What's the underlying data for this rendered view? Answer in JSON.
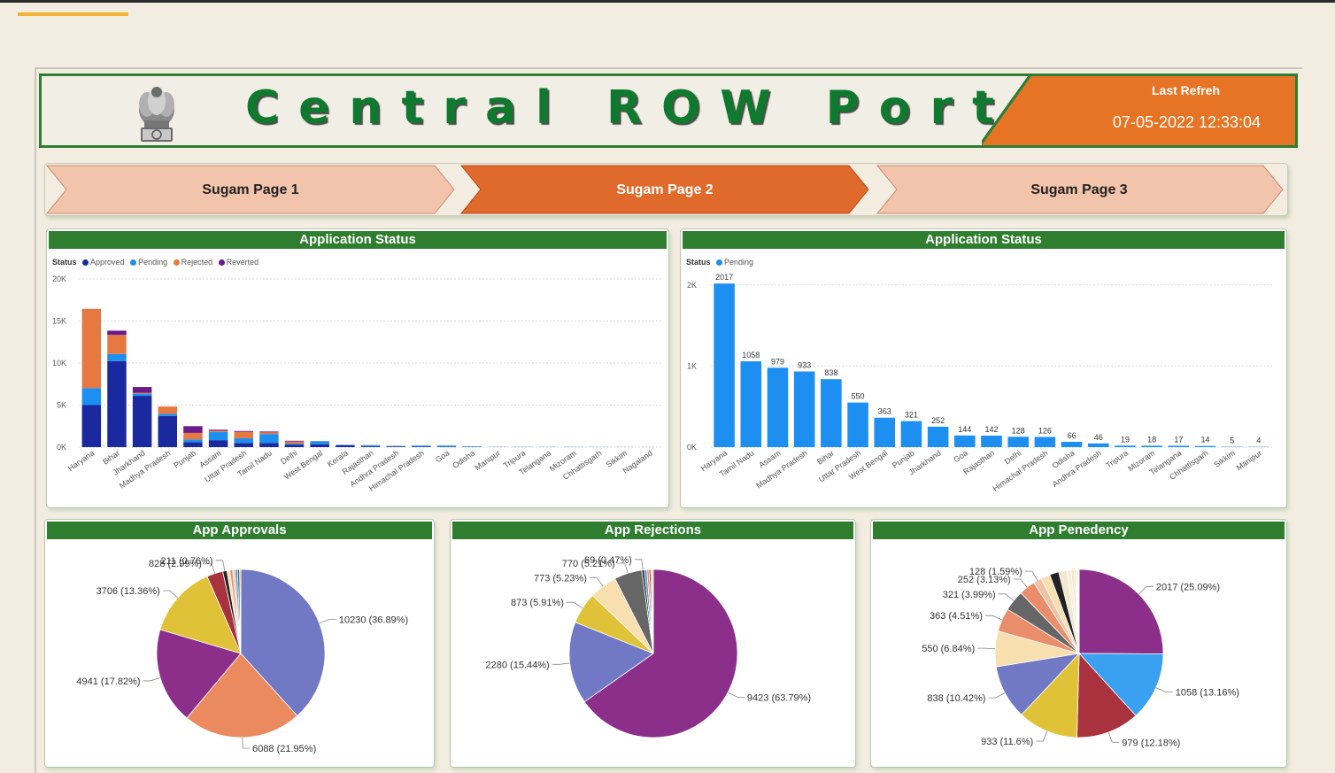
{
  "header": {
    "title": "Central ROW Portal",
    "refresh_label": "Last Refreh",
    "refresh_time": "07-05-2022 12:33:04"
  },
  "colors": {
    "green": "#2f7d2f",
    "orange": "#e06a2c",
    "pale": "#f3c4ac"
  },
  "nav": {
    "items": [
      {
        "label": "Sugam Page 1",
        "active": false
      },
      {
        "label": "Sugam Page 2",
        "active": true
      },
      {
        "label": "Sugam Page 3",
        "active": false
      }
    ]
  },
  "panels": {
    "status_title": "Application Status",
    "pending_title": "Application Status",
    "approvals_title": "App Approvals",
    "rejections_title": "App Rejections",
    "pendency_title": "App Penedency"
  },
  "legend": {
    "status_label": "Status",
    "approved": "Approved",
    "pending": "Pending",
    "rejected": "Rejected",
    "reverted": "Reverted"
  },
  "chart_data": [
    {
      "type": "bar",
      "stacked": true,
      "title": "Application Status",
      "legend_title": "Status",
      "ylim": [
        0,
        20000
      ],
      "yticks": [
        "0K",
        "5K",
        "10K",
        "15K",
        "20K"
      ],
      "categories": [
        "Haryana",
        "Bihar",
        "Jharkhand",
        "Madhya Pradesh",
        "Punjab",
        "Assam",
        "Uttar Pradesh",
        "Tamil Nadu",
        "Delhi",
        "West Bengal",
        "Kerala",
        "Rajasthan",
        "Andhra Pradesh",
        "Himachal Pradesh",
        "Goa",
        "Odisha",
        "Manipur",
        "Tripura",
        "Telangana",
        "Mizoram",
        "Chhattisgarh",
        "Sikkim",
        "Nagaland"
      ],
      "series": [
        {
          "name": "Approved",
          "color": "#1a2a9e",
          "values": [
            5000,
            10230,
            6100,
            3706,
            600,
            828,
            500,
            500,
            300,
            350,
            211,
            90,
            80,
            60,
            40,
            30,
            20,
            15,
            10,
            10,
            8,
            5,
            3
          ]
        },
        {
          "name": "Pending",
          "color": "#1c8ff0",
          "values": [
            2017,
            838,
            250,
            250,
            321,
            979,
            550,
            1058,
            128,
            363,
            60,
            142,
            66,
            126,
            144,
            66,
            4,
            19,
            17,
            18,
            14,
            5,
            2
          ]
        },
        {
          "name": "Rejected",
          "color": "#e67842",
          "values": [
            9423,
            2280,
            100,
            873,
            773,
            150,
            770,
            200,
            250,
            20,
            10,
            20,
            20,
            10,
            10,
            5,
            3,
            3,
            2,
            2,
            2,
            1,
            1
          ]
        },
        {
          "name": "Reverted",
          "color": "#6b1a8a",
          "values": [
            0,
            500,
            700,
            0,
            800,
            120,
            100,
            100,
            80,
            0,
            0,
            0,
            0,
            0,
            0,
            0,
            0,
            0,
            0,
            0,
            0,
            0,
            0
          ]
        }
      ]
    },
    {
      "type": "bar",
      "title": "Application Status",
      "legend_title": "Status",
      "ylim": [
        0,
        2500
      ],
      "yticks": [
        "0K",
        "1K",
        "2K"
      ],
      "categories": [
        "Haryana",
        "Tamil Nadu",
        "Assam",
        "Madhya Pradesh",
        "Bihar",
        "Uttar Pradesh",
        "West Bengal",
        "Punjab",
        "Jharkhand",
        "Goa",
        "Rajasthan",
        "Delhi",
        "Himachal Pradesh",
        "Odisha",
        "Andhra Pradesh",
        "Tripura",
        "Mizoram",
        "Telangana",
        "Chhattisgarh",
        "Sikkim",
        "Manipur"
      ],
      "series": [
        {
          "name": "Pending",
          "color": "#1c8ff0",
          "values": [
            2017,
            1058,
            979,
            933,
            838,
            550,
            363,
            321,
            252,
            144,
            142,
            128,
            126,
            66,
            46,
            19,
            18,
            17,
            14,
            5,
            4
          ]
        }
      ]
    },
    {
      "type": "pie",
      "title": "App Approvals",
      "values": [
        10230,
        6088,
        4941,
        3706,
        828,
        211,
        150,
        140,
        130,
        120,
        110,
        60
      ],
      "labels": [
        "10230 (36.89%)",
        "6088 (21.95%)",
        "4941 (17.82%)",
        "3706 (13.36%)",
        "828 (2.99%)",
        "211 (0.76%)",
        "",
        "",
        "",
        "",
        "",
        ""
      ],
      "colors": [
        "#7179c4",
        "#eb8a5e",
        "#8b2f8b",
        "#dfc237",
        "#a8323e",
        "#222222",
        "#f7dfb0",
        "#e98d6a",
        "#f0c2a8",
        "#3a9ad8",
        "#5a5a5a",
        "#c9a84e"
      ]
    },
    {
      "type": "pie",
      "title": "App Rejections",
      "values": [
        9423,
        2280,
        873,
        773,
        770,
        69,
        70,
        60,
        50,
        40,
        30
      ],
      "labels": [
        "9423 (63.79%)",
        "2280 (15.44%)",
        "873 (5.91%)",
        "773 (5.23%)",
        "770 (5.21%)",
        "69 (0.47%)",
        "",
        "",
        "",
        "",
        ""
      ],
      "colors": [
        "#8b2f8b",
        "#7179c4",
        "#dfc237",
        "#f7dfb0",
        "#666666",
        "#222222",
        "#3a9ad8",
        "#e98d6a",
        "#a8323e",
        "#f0c2a8",
        "#c9a84e"
      ]
    },
    {
      "type": "pie",
      "title": "App Penedency",
      "values": [
        2017,
        1058,
        979,
        933,
        838,
        550,
        363,
        321,
        252,
        128,
        144,
        142,
        126,
        66,
        46,
        19,
        18,
        17,
        14,
        5,
        4
      ],
      "labels": [
        "2017 (25.09%)",
        "1058 (13.16%)",
        "979 (12.18%)",
        "933 (11.6%)",
        "838 (10.42%)",
        "550 (6.84%)",
        "363 (4.51%)",
        "321 (3.99%)",
        "252 (3.13%)",
        "128 (1.59%)",
        "",
        "",
        "",
        "",
        "",
        "",
        "",
        "",
        "",
        "",
        ""
      ],
      "colors": [
        "#8b2f8b",
        "#3aa0f0",
        "#a8323e",
        "#dfc237",
        "#7179c4",
        "#f7dfb0",
        "#e98d6a",
        "#666666",
        "#e98d6a",
        "#f0c2a8",
        "#f7dfb0",
        "#222222",
        "#f3e8d0",
        "#fbeed8",
        "#f5e3c5",
        "#ecd5b8",
        "#e6cba8",
        "#f2e0c4",
        "#eee0cc",
        "#f7eede",
        "#faf1e4"
      ]
    }
  ]
}
